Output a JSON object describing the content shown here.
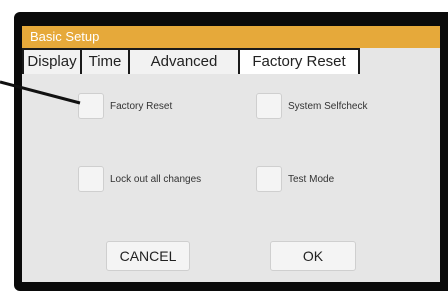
{
  "window": {
    "title": "Basic Setup"
  },
  "tabs": [
    {
      "label": "Display",
      "active": false
    },
    {
      "label": "Time",
      "active": false
    },
    {
      "label": "Advanced",
      "active": false
    },
    {
      "label": "Factory Reset",
      "active": true
    }
  ],
  "options": {
    "factory_reset": {
      "label": "Factory Reset",
      "checked": false
    },
    "system_selfcheck": {
      "label": "System Selfcheck",
      "checked": false
    },
    "lock_out": {
      "label": "Lock out all changes",
      "checked": false
    },
    "test_mode": {
      "label": "Test Mode",
      "checked": false
    }
  },
  "buttons": {
    "cancel": "CANCEL",
    "ok": "OK"
  },
  "colors": {
    "title_bar": "#e6a93a",
    "panel": "#e6e6e6",
    "frame": "#0a0a0a"
  }
}
